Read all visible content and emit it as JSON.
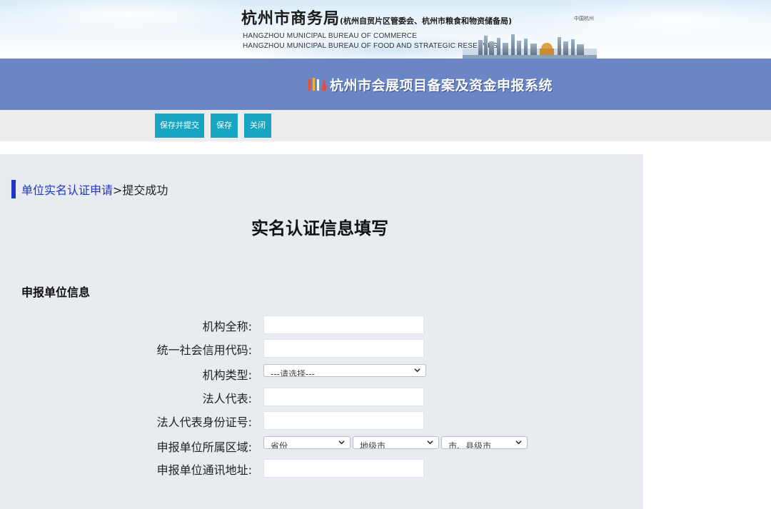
{
  "header": {
    "org_title_main": "杭州市商务局",
    "org_title_sub": "(杭州自贸片区管委会、杭州市粮食和物资储备局)",
    "org_en_line1": "HANGZHOU MUNICIPAL BUREAU OF COMMERCE",
    "org_en_line2": "HANGZHOU  MUNICIPAL BUREAU OF FOOD AND STRATEGIC RESERVES",
    "city_logo_text": "中国杭州"
  },
  "system": {
    "title": "杭州市会展项目备案及资金申报系统"
  },
  "toolbar": {
    "save_submit_label": "保存并提交",
    "save_label": "保存",
    "close_label": "关闭"
  },
  "breadcrumb": {
    "link": "单位实名认证申请",
    "rest": ">提交成功"
  },
  "form": {
    "title": "实名认证信息填写",
    "section_title": "申报单位信息",
    "fields": {
      "org_name_label": "机构全称:",
      "org_name_value": "",
      "credit_code_label": "统一社会信用代码:",
      "credit_code_value": "",
      "org_type_label": "机构类型:",
      "org_type_selected": "---请选择---",
      "legal_rep_label": "法人代表:",
      "legal_rep_value": "",
      "legal_rep_id_label": "法人代表身份证号:",
      "legal_rep_id_value": "",
      "region_label": "申报单位所属区域:",
      "province_selected": "省份",
      "city_selected": "地级市",
      "county_selected": "市、县级市",
      "address_label": "申报单位通讯地址:",
      "address_value": ""
    }
  },
  "colors": {
    "system_bar": "#6b86c6",
    "button": "#18a5c2",
    "breadcrumb_accent": "#1f35c9",
    "panel_bg": "#e8ebf0",
    "toolbar_bg": "#ededed"
  }
}
